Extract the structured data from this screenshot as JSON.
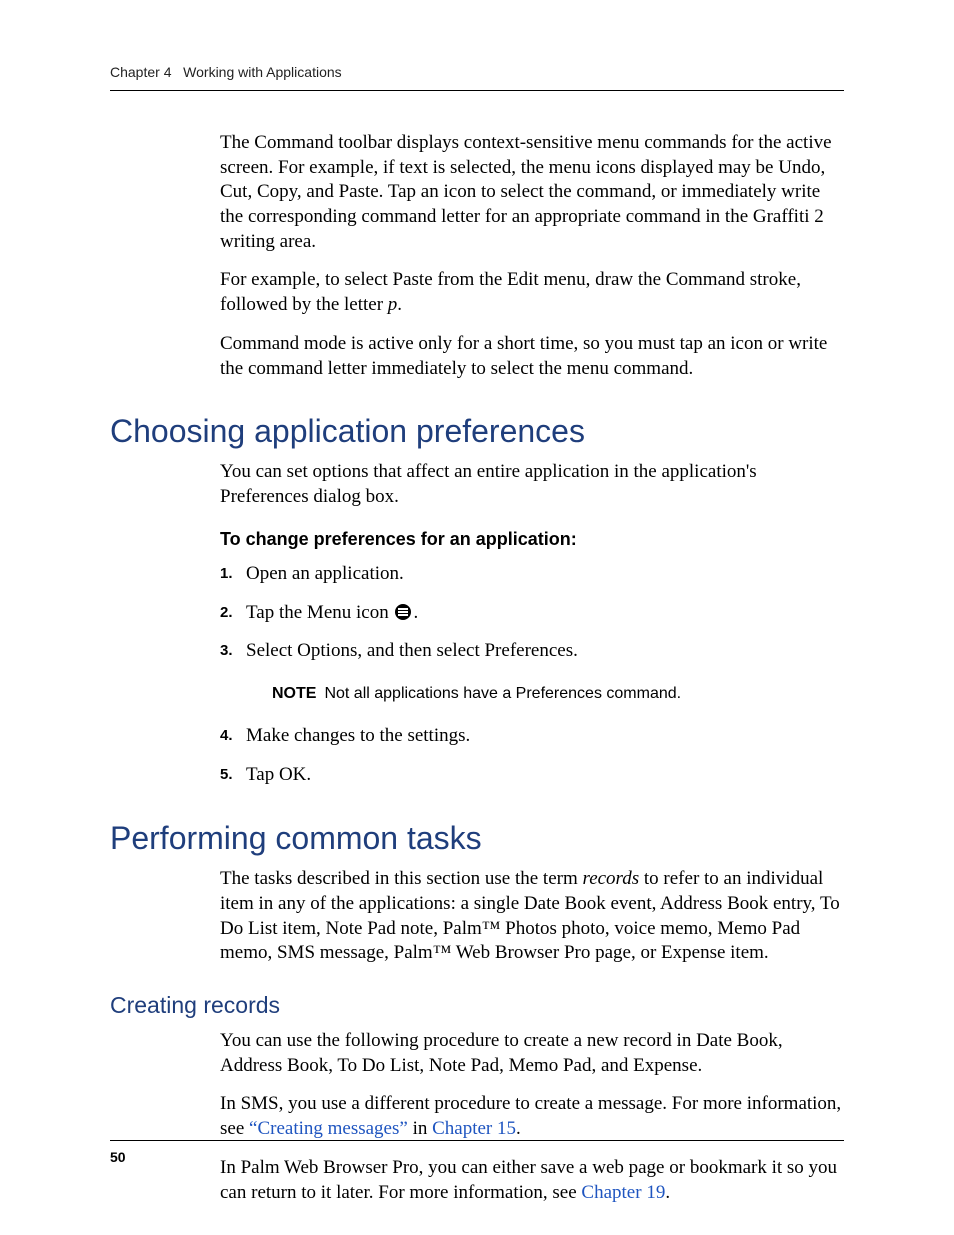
{
  "header": {
    "chapter": "Chapter 4",
    "title": "Working with Applications"
  },
  "intro": {
    "p1": "The Command toolbar displays context-sensitive menu commands for the active screen. For example, if text is selected, the menu icons displayed may be Undo, Cut, Copy, and Paste. Tap an icon to select the command, or immediately write the corresponding command letter for an appropriate command in the Graffiti 2 writing area.",
    "p2a": "For example, to select Paste from the Edit menu, draw the Command stroke, followed by the letter ",
    "p2b": "p",
    "p2c": ".",
    "p3": "Command mode is active only for a short time, so you must tap an icon or write the command letter immediately to select the menu command."
  },
  "sectionA": {
    "heading": "Choosing application preferences",
    "p1": "You can set options that affect an entire application in the application's Preferences dialog box.",
    "procTitle": "To change preferences for an application:",
    "steps": {
      "s1": "Open an application.",
      "s2a": "Tap the Menu icon ",
      "s2b": ".",
      "s3": "Select Options, and then select Preferences.",
      "noteLabel": "NOTE",
      "noteText": "Not all applications have a Preferences command.",
      "s4": "Make changes to the settings.",
      "s5": "Tap OK."
    }
  },
  "sectionB": {
    "heading": "Performing common tasks",
    "p1a": "The tasks described in this section use the term ",
    "p1b": "records",
    "p1c": " to refer to an individual item in any of the applications: a single Date Book event, Address Book entry, To Do List item, Note Pad note, Palm™ Photos photo, voice memo, Memo Pad memo, SMS message, Palm™ Web Browser Pro page, or Expense item.",
    "sub1": {
      "heading": "Creating records",
      "p1": "You can use the following procedure to create a new record in Date Book, Address Book, To Do List, Note Pad, Memo Pad, and Expense.",
      "p2a": "In SMS, you use a different procedure to create a message. For more information, see ",
      "p2link1": "“Creating messages”",
      "p2mid": " in ",
      "p2link2": "Chapter 15",
      "p2end": ".",
      "p3a": "In Palm Web Browser Pro, you can either save a web page or bookmark it so you can return to it later. For more information, see ",
      "p3link1": "Chapter 19",
      "p3end": "."
    }
  },
  "footer": {
    "pageNumber": "50"
  }
}
